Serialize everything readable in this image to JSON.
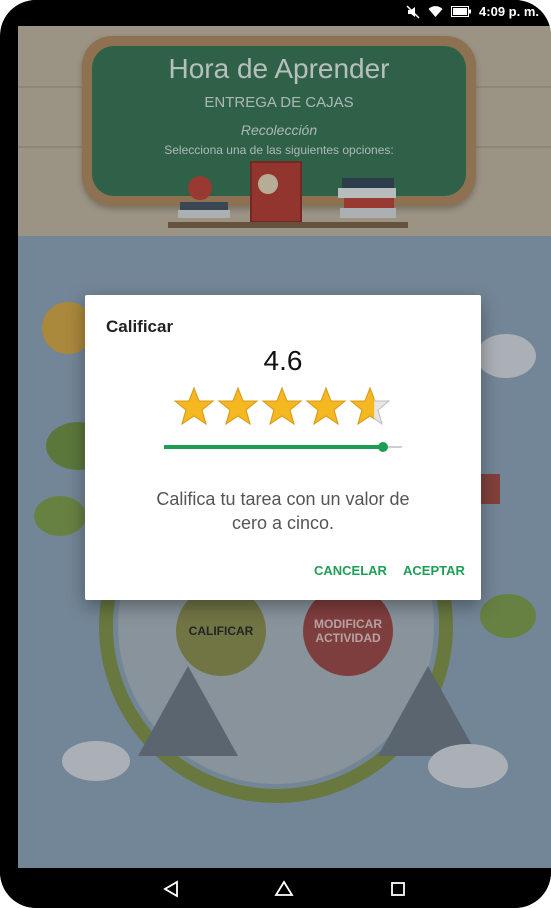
{
  "status_bar": {
    "time": "4:09 p. m.",
    "icons": [
      "mute-icon",
      "wifi-icon",
      "battery-icon"
    ]
  },
  "header": {
    "title": "Hora de Aprender",
    "subtitle": "ENTREGA DE CAJAS",
    "section": "Recolección",
    "instruction": "Selecciona una de las siguientes opciones:"
  },
  "background_actions": {
    "rate_label": "CALIFICAR",
    "modify_label": "MODIFICAR ACTIVIDAD"
  },
  "dialog": {
    "title": "Calificar",
    "rating_value": "4.6",
    "rating": 4.6,
    "max_rating": 5,
    "message": "Califica tu tarea con un valor de cero a cinco.",
    "cancel_label": "CANCELAR",
    "accept_label": "ACEPTAR"
  },
  "colors": {
    "accent": "#1e9e55",
    "star": "#f5b820",
    "chalkboard": "#2e6f4b"
  },
  "nav": {
    "icons": [
      "back-icon",
      "home-icon",
      "recents-icon"
    ]
  }
}
